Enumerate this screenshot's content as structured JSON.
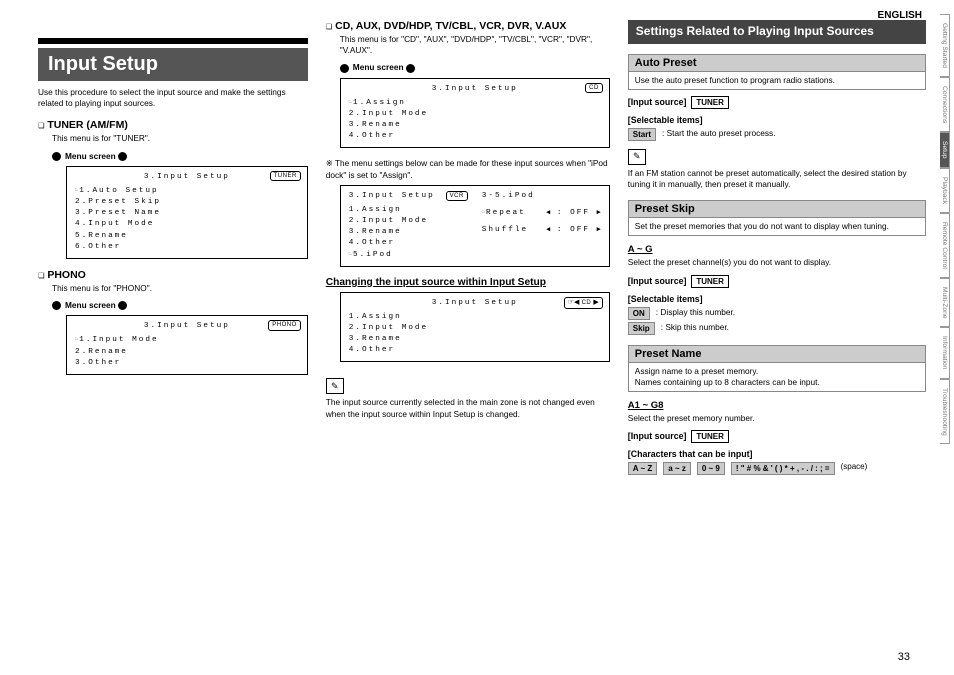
{
  "page": {
    "english": "ENGLISH",
    "number": "33"
  },
  "tabs": [
    "Getting Started",
    "Connections",
    "Setup",
    "Playback",
    "Remote Control",
    "Multi-Zone",
    "Information",
    "Troubleshooting"
  ],
  "col1": {
    "title": "Input Setup",
    "intro": "Use this procedure to select the input source and make the settings related to playing input sources.",
    "tuner": {
      "h": "TUNER (AM/FM)",
      "sub": "This menu is for \"TUNER\".",
      "menulabel": "Menu screen",
      "box": {
        "title": "3.Input Setup",
        "tag": "TUNER",
        "lines": [
          "1.Auto Setup",
          "2.Preset Skip",
          "3.Preset Name",
          "4.Input Mode",
          "5.Rename",
          "6.Other"
        ]
      }
    },
    "phono": {
      "h": "PHONO",
      "sub": "This menu is for \"PHONO\".",
      "menulabel": "Menu screen",
      "box": {
        "title": "3.Input Setup",
        "tag": "PHONO",
        "lines": [
          "1.Input Mode",
          "2.Rename",
          "3.Other"
        ]
      }
    }
  },
  "col2": {
    "top": {
      "h": "CD, AUX, DVD/HDP, TV/CBL, VCR, DVR, V.AUX",
      "sub": "This menu is for \"CD\", \"AUX\", \"DVD/HDP\", \"TV/CBL\", \"VCR\", \"DVR\", \"V.AUX\".",
      "menulabel": "Menu screen",
      "box": {
        "title": "3.Input Setup",
        "tag": "CD",
        "lines": [
          "1.Assign",
          "2.Input Mode",
          "3.Rename",
          "4.Other"
        ]
      }
    },
    "note": "The menu settings below can be made for these input sources when \"iPod dock\" is set to \"Assign\".",
    "dual": {
      "title": "3.Input Setup",
      "tag": "VCR",
      "left": [
        "1.Assign",
        "2.Input Mode",
        "3.Rename",
        "4.Other",
        "5.iPod"
      ],
      "right_h": "3-5.iPod",
      "right": [
        [
          "Repeat",
          ": OFF"
        ],
        [
          "Shuffle",
          ": OFF"
        ]
      ]
    },
    "change": {
      "h": "Changing the input source within Input Setup",
      "box": {
        "title": "3.Input Setup",
        "tag": "CD",
        "lines": [
          "1.Assign",
          "2.Input Mode",
          "3.Rename",
          "4.Other"
        ]
      }
    },
    "foot": "The input source currently selected in the main zone is not changed even when the input source within Input Setup is changed."
  },
  "col3": {
    "header": "Settings Related to Playing Input Sources",
    "auto": {
      "h": "Auto Preset",
      "box": "Use the auto preset function to program radio stations.",
      "src_label": "[Input source]",
      "src": "TUNER",
      "sel_label": "[Selectable items]",
      "item": {
        "k": "Start",
        "v": ": Start the auto preset process."
      },
      "note": "If an FM station cannot be preset automatically, select the desired station by tuning it in manually, then preset it manually."
    },
    "skip": {
      "h": "Preset Skip",
      "box": "Set the preset memories that you do not want to display when tuning.",
      "range": "A ~ G",
      "range_sub": "Select the preset channel(s) you do not want to display.",
      "src_label": "[Input source]",
      "src": "TUNER",
      "sel_label": "[Selectable items]",
      "items": [
        {
          "k": "ON",
          "v": ": Display this number."
        },
        {
          "k": "Skip",
          "v": ": Skip this number."
        }
      ]
    },
    "name": {
      "h": "Preset Name",
      "box": "Assign name to a preset memory.\nNames containing up to 8 characters can be input.",
      "range": "A1 ~ G8",
      "range_sub": "Select the preset memory number.",
      "src_label": "[Input source]",
      "src": "TUNER",
      "chars_label": "[Characters that can be input]",
      "chars": [
        "A ~ Z",
        "a ~ z",
        "0 ~ 9",
        "! \" # % & ' ( ) * + , - . / : ; ="
      ],
      "space": "(space)"
    }
  }
}
